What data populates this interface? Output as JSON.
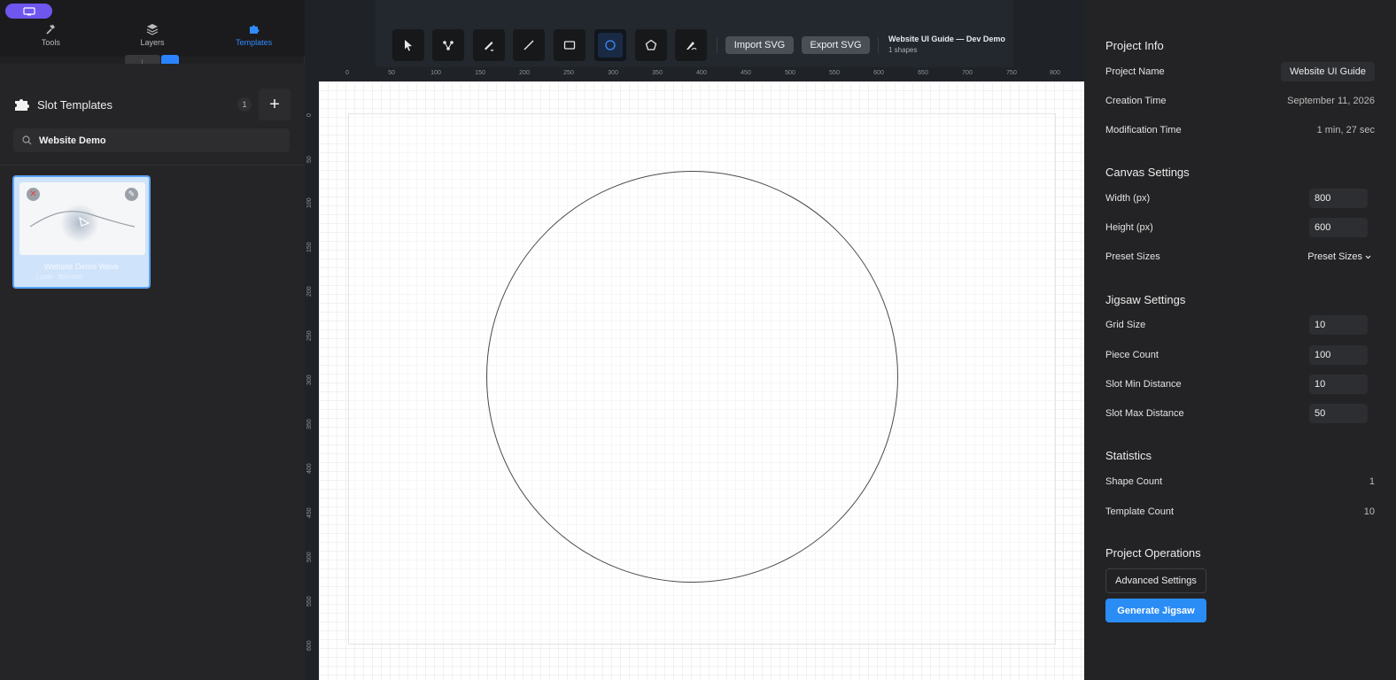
{
  "left": {
    "tabs": [
      {
        "label": "Tools",
        "icon": "hammer-icon"
      },
      {
        "label": "Layers",
        "icon": "layers-icon"
      },
      {
        "label": "Templates",
        "icon": "puzzle-icon"
      }
    ],
    "slot_title": "Slot Templates",
    "slot_count": "1",
    "add_label": "+",
    "search": {
      "value": "Website Demo"
    },
    "card": {
      "name": "Website Demo Wave",
      "sub": "1 path · 800×600"
    }
  },
  "toolbar": {
    "import_label": "Import SVG",
    "export_label": "Export SVG",
    "project_title": "Website UI Guide — Dev Demo",
    "project_sub": "1 shapes",
    "active_tool": "circle-tool"
  },
  "ruler": {
    "top": [
      "0",
      "50",
      "100",
      "150",
      "200",
      "250",
      "300",
      "350",
      "400",
      "450",
      "500",
      "550",
      "600",
      "650",
      "700",
      "750",
      "800"
    ],
    "left": [
      "0",
      "50",
      "100",
      "150",
      "200",
      "250",
      "300",
      "350",
      "400",
      "450",
      "500",
      "550",
      "600"
    ]
  },
  "right": {
    "project_info": {
      "title": "Project Info",
      "name_label": "Project Name",
      "name_value": "Website UI Guide",
      "created_label": "Creation Time",
      "created_value": "September 11, 2026",
      "modified_label": "Modification Time",
      "modified_value": "1 min, 27 sec"
    },
    "canvas": {
      "title": "Canvas Settings",
      "width_label": "Width (px)",
      "width_value": "800",
      "height_label": "Height (px)",
      "height_value": "600",
      "preset_label": "Preset Sizes",
      "preset_value": "Preset Sizes"
    },
    "jigsaw": {
      "title": "Jigsaw Settings",
      "grid_label": "Grid Size",
      "grid_value": "10",
      "piece_label": "Piece Count",
      "piece_value": "100",
      "min_label": "Slot Min Distance",
      "min_value": "10",
      "max_label": "Slot Max Distance",
      "max_value": "50"
    },
    "stats": {
      "title": "Statistics",
      "shape_label": "Shape Count",
      "shape_value": "1",
      "template_label": "Template Count",
      "template_value": "10"
    },
    "ops": {
      "title": "Project Operations",
      "advanced_label": "Advanced Settings",
      "generate_label": "Generate Jigsaw"
    }
  },
  "colors": {
    "accent": "#2a8cf5",
    "badge": "#6f56ee"
  }
}
